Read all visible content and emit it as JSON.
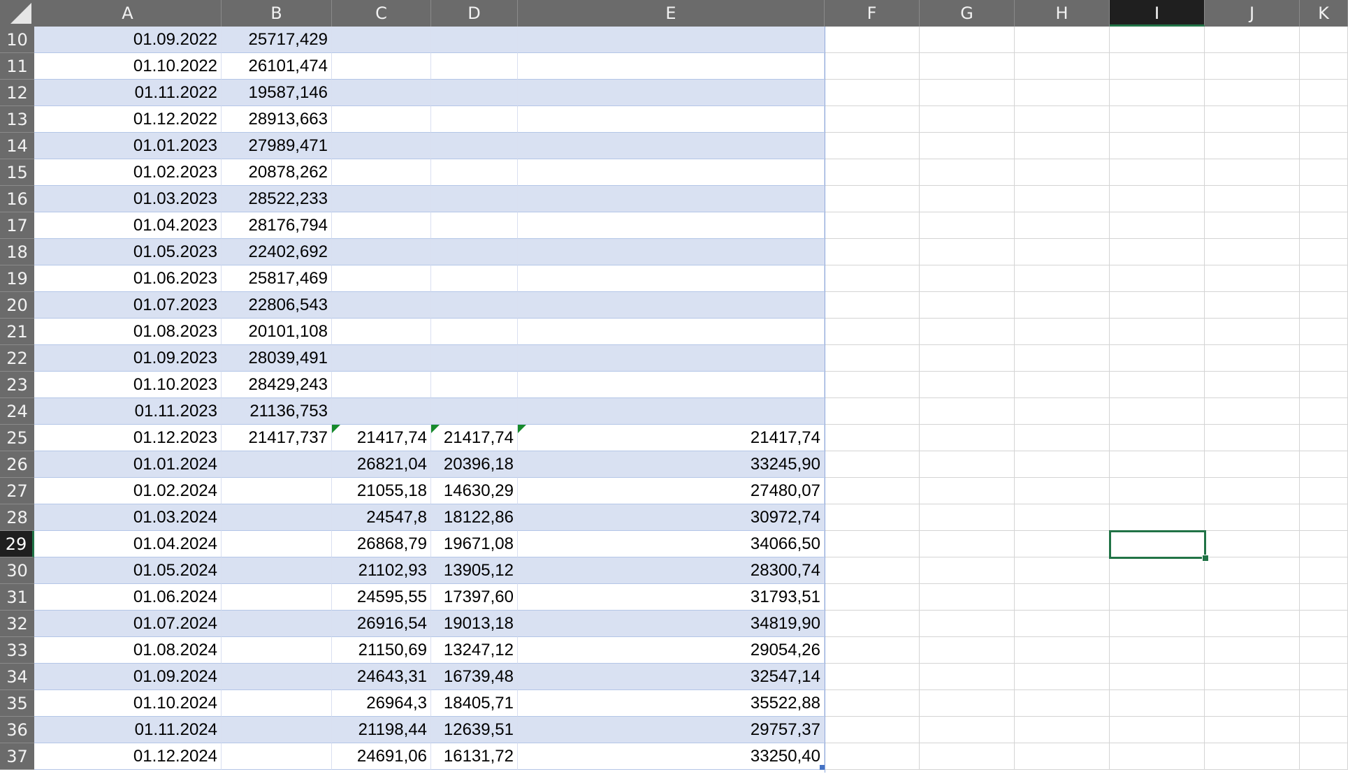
{
  "sheet": {
    "columns": [
      "A",
      "B",
      "C",
      "D",
      "E",
      "F",
      "G",
      "H",
      "I",
      "J",
      "K"
    ],
    "selected_column": "I",
    "selected_row": "29",
    "rows": [
      {
        "n": "10",
        "a": "01.09.2022",
        "b": "25717,429",
        "c": "",
        "d": "",
        "e": ""
      },
      {
        "n": "11",
        "a": "01.10.2022",
        "b": "26101,474",
        "c": "",
        "d": "",
        "e": ""
      },
      {
        "n": "12",
        "a": "01.11.2022",
        "b": "19587,146",
        "c": "",
        "d": "",
        "e": ""
      },
      {
        "n": "13",
        "a": "01.12.2022",
        "b": "28913,663",
        "c": "",
        "d": "",
        "e": ""
      },
      {
        "n": "14",
        "a": "01.01.2023",
        "b": "27989,471",
        "c": "",
        "d": "",
        "e": ""
      },
      {
        "n": "15",
        "a": "01.02.2023",
        "b": "20878,262",
        "c": "",
        "d": "",
        "e": ""
      },
      {
        "n": "16",
        "a": "01.03.2023",
        "b": "28522,233",
        "c": "",
        "d": "",
        "e": ""
      },
      {
        "n": "17",
        "a": "01.04.2023",
        "b": "28176,794",
        "c": "",
        "d": "",
        "e": ""
      },
      {
        "n": "18",
        "a": "01.05.2023",
        "b": "22402,692",
        "c": "",
        "d": "",
        "e": ""
      },
      {
        "n": "19",
        "a": "01.06.2023",
        "b": "25817,469",
        "c": "",
        "d": "",
        "e": ""
      },
      {
        "n": "20",
        "a": "01.07.2023",
        "b": "22806,543",
        "c": "",
        "d": "",
        "e": ""
      },
      {
        "n": "21",
        "a": "01.08.2023",
        "b": "20101,108",
        "c": "",
        "d": "",
        "e": ""
      },
      {
        "n": "22",
        "a": "01.09.2023",
        "b": "28039,491",
        "c": "",
        "d": "",
        "e": ""
      },
      {
        "n": "23",
        "a": "01.10.2023",
        "b": "28429,243",
        "c": "",
        "d": "",
        "e": ""
      },
      {
        "n": "24",
        "a": "01.11.2023",
        "b": "21136,753",
        "c": "",
        "d": "",
        "e": ""
      },
      {
        "n": "25",
        "a": "01.12.2023",
        "b": "21417,737",
        "c": "21417,74",
        "d": "21417,74",
        "e": "21417,74"
      },
      {
        "n": "26",
        "a": "01.01.2024",
        "b": "",
        "c": "26821,04",
        "d": "20396,18",
        "e": "33245,90"
      },
      {
        "n": "27",
        "a": "01.02.2024",
        "b": "",
        "c": "21055,18",
        "d": "14630,29",
        "e": "27480,07"
      },
      {
        "n": "28",
        "a": "01.03.2024",
        "b": "",
        "c": "24547,8",
        "d": "18122,86",
        "e": "30972,74"
      },
      {
        "n": "29",
        "a": "01.04.2024",
        "b": "",
        "c": "26868,79",
        "d": "19671,08",
        "e": "34066,50"
      },
      {
        "n": "30",
        "a": "01.05.2024",
        "b": "",
        "c": "21102,93",
        "d": "13905,12",
        "e": "28300,74"
      },
      {
        "n": "31",
        "a": "01.06.2024",
        "b": "",
        "c": "24595,55",
        "d": "17397,60",
        "e": "31793,51"
      },
      {
        "n": "32",
        "a": "01.07.2024",
        "b": "",
        "c": "26916,54",
        "d": "19013,18",
        "e": "34819,90"
      },
      {
        "n": "33",
        "a": "01.08.2024",
        "b": "",
        "c": "21150,69",
        "d": "13247,12",
        "e": "29054,26"
      },
      {
        "n": "34",
        "a": "01.09.2024",
        "b": "",
        "c": "24643,31",
        "d": "16739,48",
        "e": "32547,14"
      },
      {
        "n": "35",
        "a": "01.10.2024",
        "b": "",
        "c": "26964,3",
        "d": "18405,71",
        "e": "35522,88"
      },
      {
        "n": "36",
        "a": "01.11.2024",
        "b": "",
        "c": "21198,44",
        "d": "12639,51",
        "e": "29757,37"
      },
      {
        "n": "37",
        "a": "01.12.2024",
        "b": "",
        "c": "24691,06",
        "d": "16131,72",
        "e": "33250,40"
      }
    ],
    "colors": {
      "band": "#d9e1f2",
      "header": "#6b6b6b",
      "selection": "#217346",
      "error_flag": "#178a2c"
    },
    "icons": [
      "select-all-triangle-icon",
      "error-indicator-icon"
    ]
  }
}
